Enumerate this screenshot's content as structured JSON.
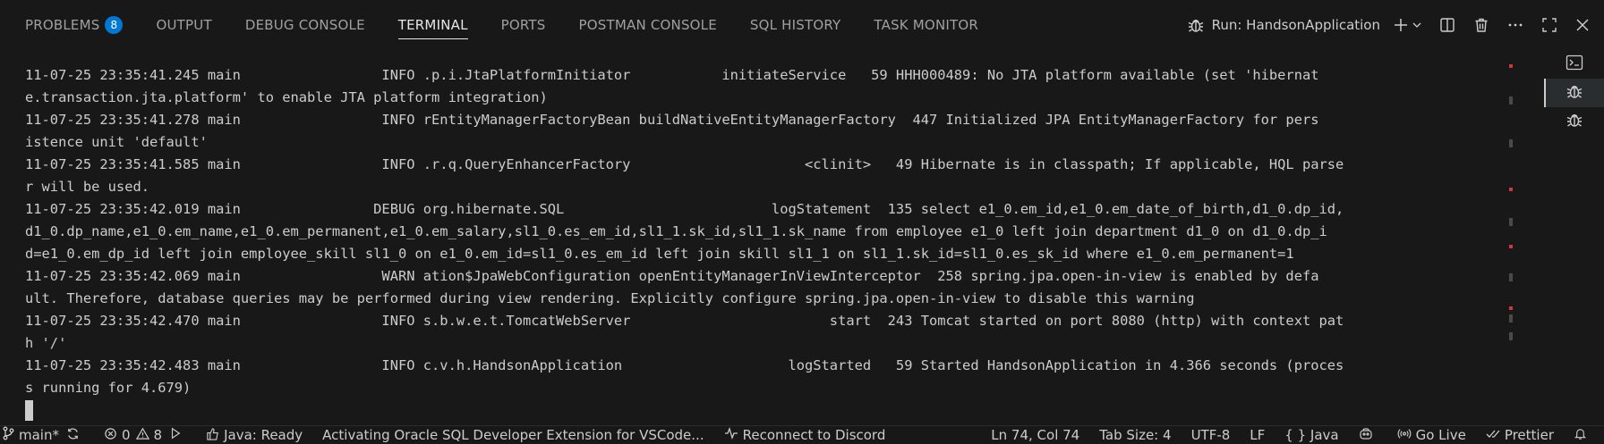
{
  "panel": {
    "tabs": [
      {
        "label": "PROBLEMS",
        "badge": "8"
      },
      {
        "label": "OUTPUT"
      },
      {
        "label": "DEBUG CONSOLE"
      },
      {
        "label": "TERMINAL",
        "active": true
      },
      {
        "label": "PORTS"
      },
      {
        "label": "POSTMAN CONSOLE"
      },
      {
        "label": "SQL HISTORY"
      },
      {
        "label": "TASK MONITOR"
      }
    ],
    "run_label": "Run: HandsonApplication"
  },
  "terminal": {
    "lines": [
      "11-07-25 23:35:41.245 main                 INFO .p.i.JtaPlatformInitiator           initiateService   59 HHH000489: No JTA platform available (set 'hibernat",
      "e.transaction.jta.platform' to enable JTA platform integration)",
      "11-07-25 23:35:41.278 main                 INFO rEntityManagerFactoryBean buildNativeEntityManagerFactory  447 Initialized JPA EntityManagerFactory for pers",
      "istence unit 'default'",
      "11-07-25 23:35:41.585 main                 INFO .r.q.QueryEnhancerFactory                     <clinit>   49 Hibernate is in classpath; If applicable, HQL parse",
      "r will be used.",
      "11-07-25 23:35:42.019 main                DEBUG org.hibernate.SQL                         logStatement  135 select e1_0.em_id,e1_0.em_date_of_birth,d1_0.dp_id,",
      "d1_0.dp_name,e1_0.em_name,e1_0.em_permanent,e1_0.em_salary,sl1_0.es_em_id,sl1_1.sk_id,sl1_1.sk_name from employee e1_0 left join department d1_0 on d1_0.dp_i",
      "d=e1_0.em_dp_id left join employee_skill sl1_0 on e1_0.em_id=sl1_0.es_em_id left join skill sl1_1 on sl1_1.sk_id=sl1_0.es_sk_id where e1_0.em_permanent=1",
      "11-07-25 23:35:42.069 main                 WARN ation$JpaWebConfiguration openEntityManagerInViewInterceptor  258 spring.jpa.open-in-view is enabled by defa",
      "ult. Therefore, database queries may be performed during view rendering. Explicitly configure spring.jpa.open-in-view to disable this warning",
      "11-07-25 23:35:42.470 main                 INFO s.b.w.e.t.TomcatWebServer                        start  243 Tomcat started on port 8080 (http) with context pat",
      "h '/'",
      "11-07-25 23:35:42.483 main                 INFO c.v.h.HandsonApplication                    logStarted   59 Started HandsonApplication in 4.366 seconds (proces",
      "s running for 4.679)"
    ]
  },
  "statusbar": {
    "branch": "main*",
    "errors": "0",
    "warnings": "8",
    "java_status": "Java: Ready",
    "activity": "Activating Oracle SQL Developer Extension for VSCode...",
    "discord": "Reconnect to Discord",
    "position": "Ln 74, Col 74",
    "tab_size": "Tab Size: 4",
    "encoding": "UTF-8",
    "eol": "LF",
    "language": "{ } Java",
    "go_live": "Go Live",
    "prettier": "Prettier"
  },
  "icons": {
    "terminal": "terminal-icon",
    "debug": "bug-icon",
    "add": "plus-icon",
    "split": "split-icon",
    "trash": "trash-icon",
    "more": "more-icon",
    "maximize": "maximize-icon",
    "close": "close-icon"
  }
}
